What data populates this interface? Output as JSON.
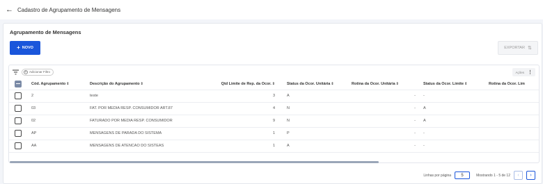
{
  "header": {
    "back_icon": "arrow-left-icon",
    "title": "Cadastro de Agrupamento de Mensagens"
  },
  "card": {
    "title": "Agrupamento de Mensagens",
    "new_button": "NOVO",
    "export_button": "EXPORTAR",
    "add_filter": "Adicionar Filtro",
    "actions": "Ações"
  },
  "table": {
    "columns": [
      "Cód. Agrupamento",
      "Descrição do Agrupamento",
      "Qtd Limite de Rep. da Ocor.",
      "Status da Ocor. Unitária",
      "Rotina da Ocor. Unitária",
      "Status da Ocor. Limite",
      "Rotina da Ocor. Lim"
    ],
    "rows": [
      {
        "code": "2",
        "desc": "teste",
        "qtd": "3",
        "status_unit": "A",
        "rotina_unit": "-",
        "status_lim": "-"
      },
      {
        "code": "03",
        "desc": "FAT. POR MEDIA RESP. CONSUMIDOR ART.87",
        "qtd": "4",
        "status_unit": "N",
        "rotina_unit": "-",
        "status_lim": "A"
      },
      {
        "code": "02",
        "desc": "FATURADO POR MEDIA RESP. CONSUMIDOR",
        "qtd": "9",
        "status_unit": "N",
        "rotina_unit": "-",
        "status_lim": "A"
      },
      {
        "code": "AP",
        "desc": "MENSAGENS DE PARADA DO SISTEMA",
        "qtd": "1",
        "status_unit": "P",
        "rotina_unit": "-",
        "status_lim": "-"
      },
      {
        "code": "AA",
        "desc": "MENSAGENS DE ATENCAO DO SISTEAS",
        "qtd": "1",
        "status_unit": "A",
        "rotina_unit": "-",
        "status_lim": "-"
      }
    ]
  },
  "pagination": {
    "rows_per_page_label": "Linhas por página",
    "rows_per_page": "5",
    "range_text": "Mostrando 1 - 5 de 12"
  },
  "colors": {
    "primary": "#1a56db",
    "background": "#f3f5f9"
  }
}
